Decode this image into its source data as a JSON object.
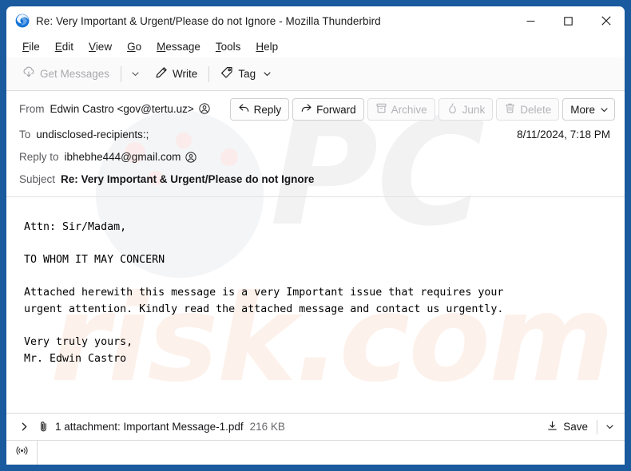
{
  "window": {
    "title": "Re: Very Important & Urgent/Please do not Ignore - Mozilla Thunderbird",
    "app_icon": "thunderbird-icon",
    "minimize_label": "Minimize",
    "maximize_label": "Maximize",
    "close_label": "Close",
    "border_color": "#1a5a9e"
  },
  "menu": {
    "items": [
      {
        "label": "File",
        "accesskey": "F"
      },
      {
        "label": "Edit",
        "accesskey": "E"
      },
      {
        "label": "View",
        "accesskey": "V"
      },
      {
        "label": "Go",
        "accesskey": "G"
      },
      {
        "label": "Message",
        "accesskey": "M"
      },
      {
        "label": "Tools",
        "accesskey": "T"
      },
      {
        "label": "Help",
        "accesskey": "H"
      }
    ]
  },
  "toolbar": {
    "get_messages_label": "Get Messages",
    "get_messages_icon": "download-cloud-icon",
    "get_messages_disabled": true,
    "get_messages_caret_icon": "chevron-down-icon",
    "write_label": "Write",
    "write_icon": "pencil-icon",
    "tag_label": "Tag",
    "tag_icon": "tag-icon",
    "tag_caret_icon": "chevron-down-icon"
  },
  "header": {
    "from_label": "From",
    "from_value": "Edwin Castro <gov@tertu.uz>",
    "from_contact_icon": "person-circle-icon",
    "to_label": "To",
    "to_value": "undisclosed-recipients:;",
    "reply_to_label": "Reply to",
    "reply_to_value": "ibhebhe444@gmail.com",
    "reply_to_contact_icon": "person-circle-icon",
    "subject_label": "Subject",
    "subject_value": "Re: Very Important & Urgent/Please do not Ignore",
    "date": "8/11/2024, 7:18 PM",
    "actions": [
      {
        "label": "Reply",
        "icon": "reply-arrow-icon",
        "disabled": false
      },
      {
        "label": "Forward",
        "icon": "forward-arrow-icon",
        "disabled": false
      },
      {
        "label": "Archive",
        "icon": "archive-box-icon",
        "disabled": true
      },
      {
        "label": "Junk",
        "icon": "flame-icon",
        "disabled": true
      },
      {
        "label": "Delete",
        "icon": "trash-icon",
        "disabled": true
      },
      {
        "label": "More",
        "icon": "chevron-down-icon",
        "disabled": false
      }
    ]
  },
  "message_body": "Attn: Sir/Madam,\n\nTO WHOM IT MAY CONCERN\n\nAttached herewith this message is a very Important issue that requires your\nurgent attention. Kindly read the attached message and contact us urgently.\n\nVery truly yours,\nMr. Edwin Castro",
  "attachment": {
    "twisty_icon": "chevron-right-icon",
    "paperclip_icon": "paperclip-icon",
    "summary": "1 attachment: Important Message-1.pdf",
    "size": "216 KB",
    "save_label": "Save",
    "save_icon": "download-icon",
    "save_caret_icon": "chevron-down-icon"
  },
  "status_bar": {
    "connection_icon": "broadcast-antenna-icon"
  }
}
